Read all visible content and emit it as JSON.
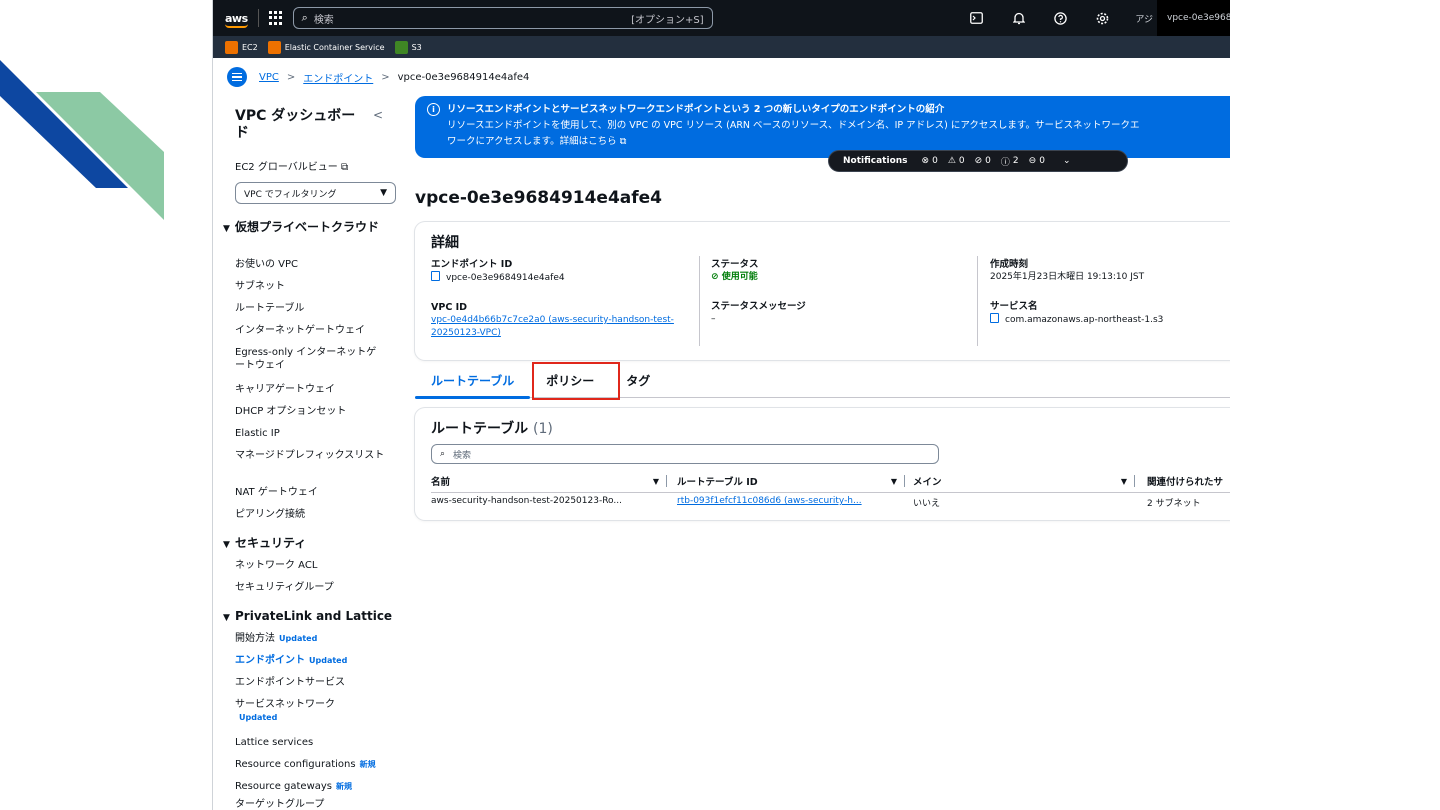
{
  "colors": {
    "accent": "#006ce0",
    "highlight": "#e0271b",
    "ok": "#037f0c",
    "deco_blue": "#0d47a1",
    "deco_green": "#8cc9a4"
  },
  "topbar": {
    "logo": "aws",
    "search_placeholder": "検索",
    "search_shortcut": "[オプション+S]",
    "region": "アジ",
    "account": "vpce-0e3e9684"
  },
  "favorites": [
    {
      "label": "EC2",
      "color": "#ed7100"
    },
    {
      "label": "Elastic Container Service",
      "color": "#ed7100"
    },
    {
      "label": "S3",
      "color": "#3f8624"
    }
  ],
  "breadcrumb": {
    "vpc": "VPC",
    "endpoints": "エンドポイント",
    "current": "vpce-0e3e9684914e4afe4"
  },
  "sidebar": {
    "title": "VPC ダッシュボード",
    "ec2_link": "EC2 グローバルビュー",
    "filter": "VPC でフィルタリング",
    "sections": [
      {
        "title": "仮想プライベートクラウド",
        "items": [
          "お使いの VPC",
          "サブネット",
          "ルートテーブル",
          "インターネットゲートウェイ",
          "Egress-only インターネットゲートウェイ",
          "キャリアゲートウェイ",
          "DHCP オプションセット",
          "Elastic IP",
          "マネージドプレフィックスリスト",
          "NAT ゲートウェイ",
          "ピアリング接続"
        ]
      },
      {
        "title": "セキュリティ",
        "items": [
          "ネットワーク ACL",
          "セキュリティグループ"
        ]
      },
      {
        "title": "PrivateLink and Lattice",
        "items": [
          "開始方法",
          "エンドポイント",
          "エンドポイントサービス",
          "サービスネットワーク",
          "Lattice services",
          "Resource configurations",
          "Resource gateways",
          "ターゲットグループ"
        ]
      }
    ],
    "badge_updated": "Updated",
    "badge_new": "新規"
  },
  "flash": {
    "title": "リソースエンドポイントとサービスネットワークエンドポイントという 2 つの新しいタイプのエンドポイントの紹介",
    "body1": "リソースエンドポイントを使用して、別の VPC の VPC リソース (ARN ベースのリソース、ドメイン名、IP アドレス) にアクセスします。サービスネットワークエ",
    "body2": "ワークにアクセスします。詳細はこちら"
  },
  "notifications": {
    "label": "Notifications",
    "error": "0",
    "warning": "0",
    "success": "0",
    "info": "2",
    "progress": "0"
  },
  "page_title": "vpce-0e3e9684914e4afe4",
  "details": {
    "heading": "詳細",
    "endpoint_id_label": "エンドポイント ID",
    "endpoint_id": "vpce-0e3e9684914e4afe4",
    "vpc_id_label": "VPC ID",
    "vpc_id": "vpc-0e4d4b66b7c7ce2a0 (aws-security-handson-test-20250123-VPC)",
    "status_label": "ステータス",
    "status": "使用可能",
    "status_msg_label": "ステータスメッセージ",
    "status_msg": "–",
    "created_label": "作成時刻",
    "created": "2025年1月23日木曜日 19:13:10 JST",
    "service_label": "サービス名",
    "service": "com.amazonaws.ap-northeast-1.s3"
  },
  "tabs": [
    "ルートテーブル",
    "ポリシー",
    "タグ"
  ],
  "route_tables": {
    "title": "ルートテーブル",
    "count": "(1)",
    "search_placeholder": "検索",
    "columns": [
      "名前",
      "ルートテーブル ID",
      "メイン",
      "関連付けられたサ"
    ],
    "rows": [
      {
        "name": "aws-security-handson-test-20250123-Ro...",
        "id": "rtb-093f1efcf11c086d6 (aws-security-h...",
        "main": "いいえ",
        "assoc": "2 サブネット"
      }
    ]
  }
}
